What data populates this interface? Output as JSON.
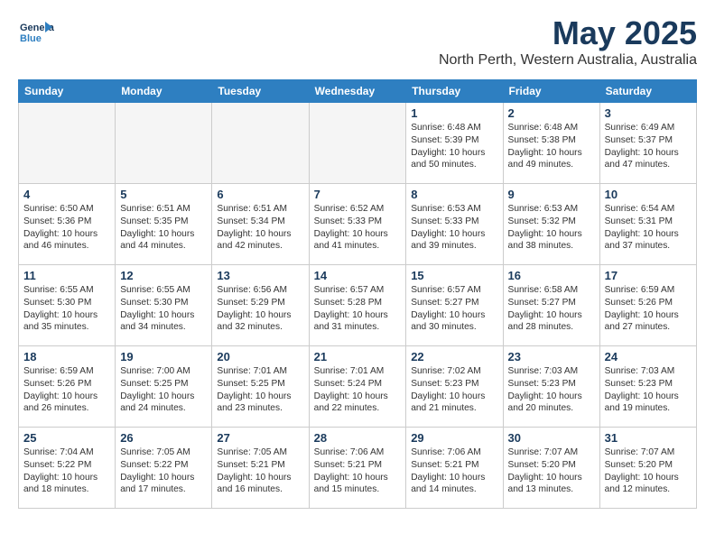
{
  "logo": {
    "line1": "General",
    "line2": "Blue"
  },
  "title": "May 2025",
  "subtitle": "North Perth, Western Australia, Australia",
  "headers": [
    "Sunday",
    "Monday",
    "Tuesday",
    "Wednesday",
    "Thursday",
    "Friday",
    "Saturday"
  ],
  "weeks": [
    [
      {
        "day": "",
        "info": ""
      },
      {
        "day": "",
        "info": ""
      },
      {
        "day": "",
        "info": ""
      },
      {
        "day": "",
        "info": ""
      },
      {
        "day": "1",
        "info": "Sunrise: 6:48 AM\nSunset: 5:39 PM\nDaylight: 10 hours\nand 50 minutes."
      },
      {
        "day": "2",
        "info": "Sunrise: 6:48 AM\nSunset: 5:38 PM\nDaylight: 10 hours\nand 49 minutes."
      },
      {
        "day": "3",
        "info": "Sunrise: 6:49 AM\nSunset: 5:37 PM\nDaylight: 10 hours\nand 47 minutes."
      }
    ],
    [
      {
        "day": "4",
        "info": "Sunrise: 6:50 AM\nSunset: 5:36 PM\nDaylight: 10 hours\nand 46 minutes."
      },
      {
        "day": "5",
        "info": "Sunrise: 6:51 AM\nSunset: 5:35 PM\nDaylight: 10 hours\nand 44 minutes."
      },
      {
        "day": "6",
        "info": "Sunrise: 6:51 AM\nSunset: 5:34 PM\nDaylight: 10 hours\nand 42 minutes."
      },
      {
        "day": "7",
        "info": "Sunrise: 6:52 AM\nSunset: 5:33 PM\nDaylight: 10 hours\nand 41 minutes."
      },
      {
        "day": "8",
        "info": "Sunrise: 6:53 AM\nSunset: 5:33 PM\nDaylight: 10 hours\nand 39 minutes."
      },
      {
        "day": "9",
        "info": "Sunrise: 6:53 AM\nSunset: 5:32 PM\nDaylight: 10 hours\nand 38 minutes."
      },
      {
        "day": "10",
        "info": "Sunrise: 6:54 AM\nSunset: 5:31 PM\nDaylight: 10 hours\nand 37 minutes."
      }
    ],
    [
      {
        "day": "11",
        "info": "Sunrise: 6:55 AM\nSunset: 5:30 PM\nDaylight: 10 hours\nand 35 minutes."
      },
      {
        "day": "12",
        "info": "Sunrise: 6:55 AM\nSunset: 5:30 PM\nDaylight: 10 hours\nand 34 minutes."
      },
      {
        "day": "13",
        "info": "Sunrise: 6:56 AM\nSunset: 5:29 PM\nDaylight: 10 hours\nand 32 minutes."
      },
      {
        "day": "14",
        "info": "Sunrise: 6:57 AM\nSunset: 5:28 PM\nDaylight: 10 hours\nand 31 minutes."
      },
      {
        "day": "15",
        "info": "Sunrise: 6:57 AM\nSunset: 5:27 PM\nDaylight: 10 hours\nand 30 minutes."
      },
      {
        "day": "16",
        "info": "Sunrise: 6:58 AM\nSunset: 5:27 PM\nDaylight: 10 hours\nand 28 minutes."
      },
      {
        "day": "17",
        "info": "Sunrise: 6:59 AM\nSunset: 5:26 PM\nDaylight: 10 hours\nand 27 minutes."
      }
    ],
    [
      {
        "day": "18",
        "info": "Sunrise: 6:59 AM\nSunset: 5:26 PM\nDaylight: 10 hours\nand 26 minutes."
      },
      {
        "day": "19",
        "info": "Sunrise: 7:00 AM\nSunset: 5:25 PM\nDaylight: 10 hours\nand 24 minutes."
      },
      {
        "day": "20",
        "info": "Sunrise: 7:01 AM\nSunset: 5:25 PM\nDaylight: 10 hours\nand 23 minutes."
      },
      {
        "day": "21",
        "info": "Sunrise: 7:01 AM\nSunset: 5:24 PM\nDaylight: 10 hours\nand 22 minutes."
      },
      {
        "day": "22",
        "info": "Sunrise: 7:02 AM\nSunset: 5:23 PM\nDaylight: 10 hours\nand 21 minutes."
      },
      {
        "day": "23",
        "info": "Sunrise: 7:03 AM\nSunset: 5:23 PM\nDaylight: 10 hours\nand 20 minutes."
      },
      {
        "day": "24",
        "info": "Sunrise: 7:03 AM\nSunset: 5:23 PM\nDaylight: 10 hours\nand 19 minutes."
      }
    ],
    [
      {
        "day": "25",
        "info": "Sunrise: 7:04 AM\nSunset: 5:22 PM\nDaylight: 10 hours\nand 18 minutes."
      },
      {
        "day": "26",
        "info": "Sunrise: 7:05 AM\nSunset: 5:22 PM\nDaylight: 10 hours\nand 17 minutes."
      },
      {
        "day": "27",
        "info": "Sunrise: 7:05 AM\nSunset: 5:21 PM\nDaylight: 10 hours\nand 16 minutes."
      },
      {
        "day": "28",
        "info": "Sunrise: 7:06 AM\nSunset: 5:21 PM\nDaylight: 10 hours\nand 15 minutes."
      },
      {
        "day": "29",
        "info": "Sunrise: 7:06 AM\nSunset: 5:21 PM\nDaylight: 10 hours\nand 14 minutes."
      },
      {
        "day": "30",
        "info": "Sunrise: 7:07 AM\nSunset: 5:20 PM\nDaylight: 10 hours\nand 13 minutes."
      },
      {
        "day": "31",
        "info": "Sunrise: 7:07 AM\nSunset: 5:20 PM\nDaylight: 10 hours\nand 12 minutes."
      }
    ]
  ]
}
